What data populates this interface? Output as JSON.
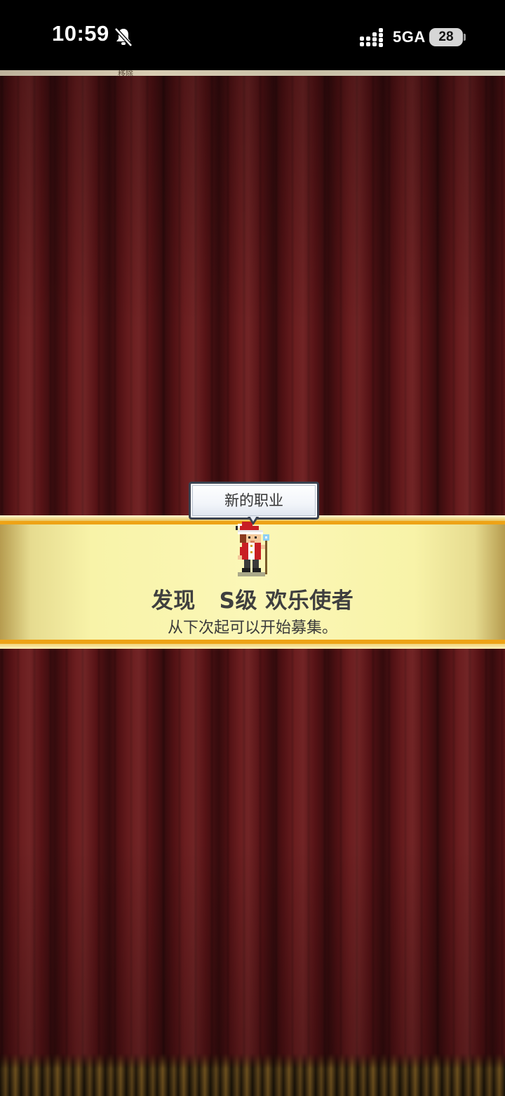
{
  "status_bar": {
    "time": "10:59",
    "network": "5GA",
    "battery": "28",
    "icons": [
      "bell-muted-icon",
      "signal-icon"
    ]
  },
  "top_strip": {
    "partial_text": "移除"
  },
  "banner": {
    "speech_bubble": "新的职业",
    "title": "发现   S级 欢乐使者",
    "subtitle": "从下次起可以开始募集。"
  },
  "colors": {
    "curtain": "#5a1316",
    "banner_fill": "#fbf7b7",
    "banner_stripe": "#eea316",
    "bubble_border": "#3a4250",
    "character_red": "#c81e24"
  }
}
